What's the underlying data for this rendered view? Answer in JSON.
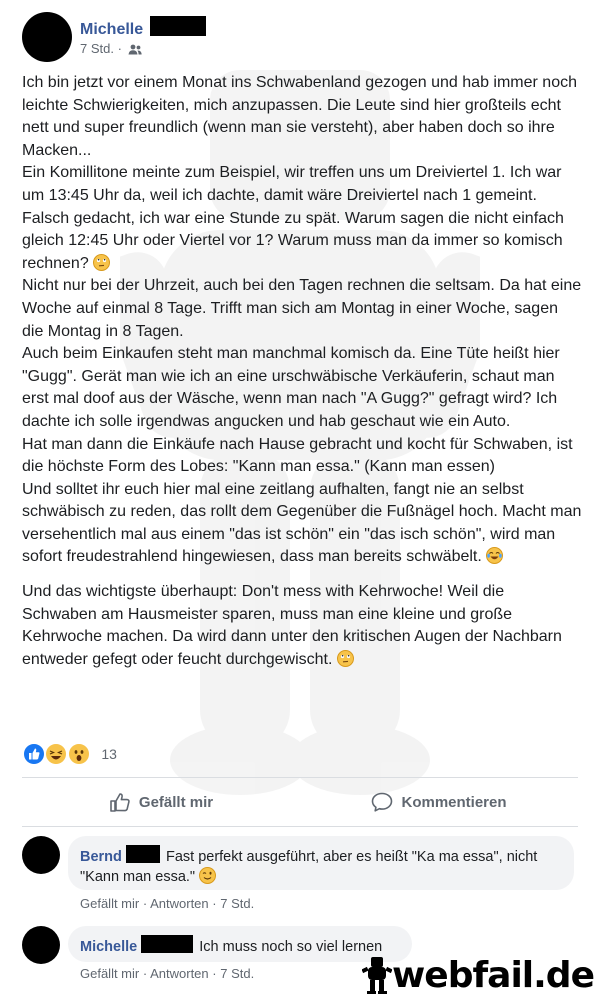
{
  "post": {
    "author": "Michelle",
    "time": "7 Std.",
    "separator": "·",
    "audience_icon": "friends-icon",
    "paragraphs": [
      "Ich bin jetzt vor einem Monat ins Schwabenland gezogen und hab immer noch leichte Schwierigkeiten, mich anzupassen. Die Leute sind hier großteils echt nett und super freundlich (wenn man sie versteht), aber haben doch so ihre Macken...",
      "Ein Komillitone meinte zum Beispiel, wir treffen uns um Dreiviertel 1. Ich war um 13:45 Uhr da, weil ich dachte, damit wäre Dreiviertel nach 1 gemeint. Falsch gedacht, ich war eine Stunde zu spät. Warum sagen die nicht einfach gleich 12:45 Uhr oder Viertel vor 1? Warum muss man da immer so komisch rechnen?",
      "Nicht nur bei der Uhrzeit, auch bei den Tagen rechnen die seltsam. Da hat eine Woche auf einmal 8 Tage. Trifft man sich am Montag in einer Woche, sagen die Montag in 8 Tagen.",
      "Auch beim Einkaufen steht man manchmal komisch da. Eine Tüte heißt hier \"Gugg\". Gerät man wie ich an eine urschwäbische Verkäuferin, schaut man erst mal doof aus der Wäsche, wenn man nach \"A Gugg?\" gefragt wird? Ich dachte ich solle irgendwas angucken und hab geschaut wie ein Auto.",
      "Hat man dann die Einkäufe nach Hause gebracht und kocht für Schwaben, ist die höchste Form des Lobes: \"Kann man essa.\" (Kann man essen)",
      "Und solltet ihr euch hier mal eine zeitlang aufhalten, fangt nie an selbst schwäbisch zu reden, das rollt dem Gegenüber die Fußnägel hoch. Macht man versehentlich mal aus einem \"das ist schön\" ein \"das isch schön\", wird man sofort freudestrahlend hingewiesen, dass man bereits schwäbelt.",
      "Und das wichtigste überhaupt: Don't mess with Kehrwoche! Weil die Schwaben am Hausmeister sparen, muss man eine kleine und große Kehrwoche machen. Da wird dann unter den kritischen Augen der Nachbarn entweder gefegt oder feucht durchgewischt."
    ],
    "reaction_count": "13",
    "like_label": "Gefällt mir",
    "comment_label": "Kommentieren"
  },
  "comments": [
    {
      "author": "Bernd",
      "text": "Fast perfekt ausgeführt, aber es heißt \"Ka ma essa\", nicht \"Kann man essa.\"",
      "like": "Gefällt mir",
      "reply": "Antworten",
      "time": "7 Std."
    },
    {
      "author": "Michelle",
      "text": "Ich muss noch so viel lernen",
      "like": "Gefällt mir",
      "reply": "Antworten",
      "time": "7 Std."
    }
  ],
  "brand": {
    "text": "webfail.de",
    "logo": "webfail-mascot-logo"
  }
}
